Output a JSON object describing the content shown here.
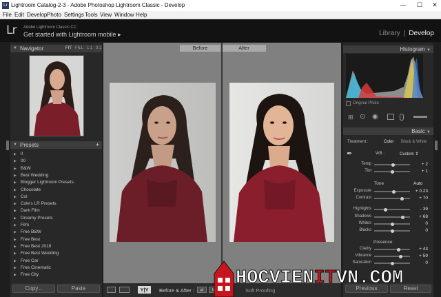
{
  "window": {
    "title": "Lightroom Catalog-2-3 - Adobe Photoshop Lightroom Classic - Develop",
    "app_icon": "Lr"
  },
  "menu": [
    "File",
    "Edit",
    "Develop",
    "Photo",
    "Settings",
    "Tools",
    "View",
    "Window",
    "Help"
  ],
  "identity": {
    "logo": "Lr",
    "product": "Adobe Lightroom Classic CC",
    "message": "Get started with Lightroom mobile",
    "arrow": "▸"
  },
  "modules": {
    "library": "Library",
    "separator": "|",
    "develop": "Develop"
  },
  "navigator": {
    "title": "Navigator",
    "zoom": [
      "FIT",
      "FILL",
      "1:1",
      "3:1"
    ]
  },
  "presets": {
    "title": "Presets",
    "add": "+",
    "items": [
      "0",
      "00",
      "B&W",
      "Best Wedding",
      "Blogger Lightroom Presets",
      "Chocolate",
      "Col",
      "Cole's LR Presets",
      "Dark Film",
      "Dreamy Presets",
      "Film",
      "Free B&W",
      "Free Best",
      "Free Best 2018",
      "Free Best Wedding",
      "Free Car",
      "Free Cinematic",
      "Free City"
    ]
  },
  "left_buttons": {
    "copy": "Copy...",
    "paste": "Paste"
  },
  "center": {
    "before": "Before",
    "after": "After"
  },
  "toolbar": {
    "view_label": "Y|Y",
    "mode": "Before & After :",
    "soft_proofing": "Soft Proofing"
  },
  "histogram": {
    "title": "Histogram",
    "original_photo": "Original Photo"
  },
  "basic": {
    "title": "Basic",
    "treatment_label": "Treatment :",
    "color": "Color",
    "bw": "Black & White",
    "wb_label": "WB :",
    "wb_value": "Custom",
    "tone_label": "Tone",
    "auto": "Auto",
    "presence_label": "Presence",
    "sliders": [
      {
        "label": "Temp",
        "value": "+ 2",
        "pos": 0.52
      },
      {
        "label": "Tint",
        "value": "+ 1",
        "pos": 0.51
      },
      {
        "label": "Exposure",
        "value": "+ 0.23",
        "pos": 0.55
      },
      {
        "label": "Contrast",
        "value": "+ 70",
        "pos": 0.78
      },
      {
        "label": "Highlights",
        "value": "- 39",
        "pos": 0.32
      },
      {
        "label": "Shadows",
        "value": "+ 68",
        "pos": 0.8
      },
      {
        "label": "Whites",
        "value": "0",
        "pos": 0.5
      },
      {
        "label": "Blacks",
        "value": "0",
        "pos": 0.5
      },
      {
        "label": "Clarity",
        "value": "+ 43",
        "pos": 0.68
      },
      {
        "label": "Vibrance",
        "value": "+ 59",
        "pos": 0.74
      },
      {
        "label": "Saturation",
        "value": "0",
        "pos": 0.5
      }
    ]
  },
  "right_buttons": {
    "previous": "Previous",
    "reset": "Reset"
  },
  "watermark": {
    "pre": "HOCVIEN",
    "mid": "IT",
    "post": "VN.COM"
  },
  "colors": {
    "accent": "#c5161d",
    "panel": "#282828",
    "header": "#3c3c3c"
  }
}
